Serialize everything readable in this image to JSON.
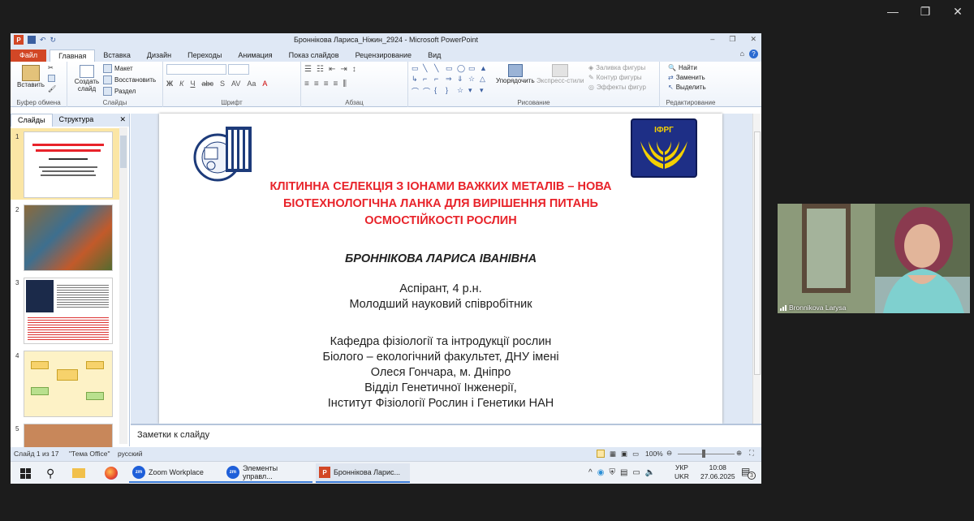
{
  "window_controls": {
    "min": "—",
    "restore": "❐",
    "close": "✕"
  },
  "ppt": {
    "title": "Броннікова Лариса_Ніжин_2924 - Microsoft PowerPoint",
    "tabs": [
      "Файл",
      "Главная",
      "Вставка",
      "Дизайн",
      "Переходы",
      "Анимация",
      "Показ слайдов",
      "Рецензирование",
      "Вид"
    ],
    "ribbon": {
      "paste": "Вставить",
      "clipboard_group": "Буфер обмена",
      "new_slide": "Создать слайд",
      "layout": "Макет",
      "reset": "Восстановить",
      "section": "Раздел",
      "slides_group": "Слайды",
      "font_group": "Шрифт",
      "paragraph_group": "Абзац",
      "arrange": "Упорядочить",
      "quick_styles": "Экспресс-стили",
      "shape_fill": "Заливка фигуры",
      "shape_outline": "Контур фигуры",
      "shape_effects": "Эффекты фигур",
      "drawing_group": "Рисование",
      "find": "Найти",
      "replace": "Заменить",
      "select": "Выделить",
      "editing_group": "Редактирование"
    },
    "pane_tabs": {
      "slides": "Слайды",
      "outline": "Структура"
    },
    "thumbs": [
      "1",
      "2",
      "3",
      "4",
      "5"
    ],
    "slide": {
      "logo_right": "ІФРГ",
      "title_lines": [
        "КЛІТИННА СЕЛЕКЦІЯ З ІОНАМИ ВАЖКИХ МЕТАЛІВ – НОВА",
        "БІОТЕХНОЛОГІЧНА  ЛАНКА ДЛЯ ВИРІШЕННЯ ПИТАНЬ",
        "ОСМОСТІЙКОСТІ РОСЛИН"
      ],
      "author": "БРОННІКОВА ЛАРИСА ІВАНІВНА",
      "role1": "Аспірант, 4 р.н.",
      "role2": "Молодший науковий співробітник",
      "dept_lines": [
        "Кафедра фізіології та інтродукції рослин",
        "Біолого – екологічний факультет, ДНУ імені",
        "Олеся Гончара, м. Дніпро",
        "Відділ Генетичної Інженерії,",
        "Інститут Фізіології Рослин і Генетики НАН"
      ]
    },
    "notes_placeholder": "Заметки к слайду",
    "status": {
      "slide": "Слайд 1 из 17",
      "theme": "\"Тема Office\"",
      "lang": "русский",
      "zoom": "100%"
    }
  },
  "taskbar": {
    "apps": [
      "Zoom Workplace",
      "Элементы управл...",
      "Броннікова Ларис..."
    ],
    "lang1": "УКР",
    "lang2": "UKR",
    "time": "10:08",
    "date": "27.06.2025",
    "notif": "3"
  },
  "video": {
    "name": "Bronnikova Larysa"
  }
}
